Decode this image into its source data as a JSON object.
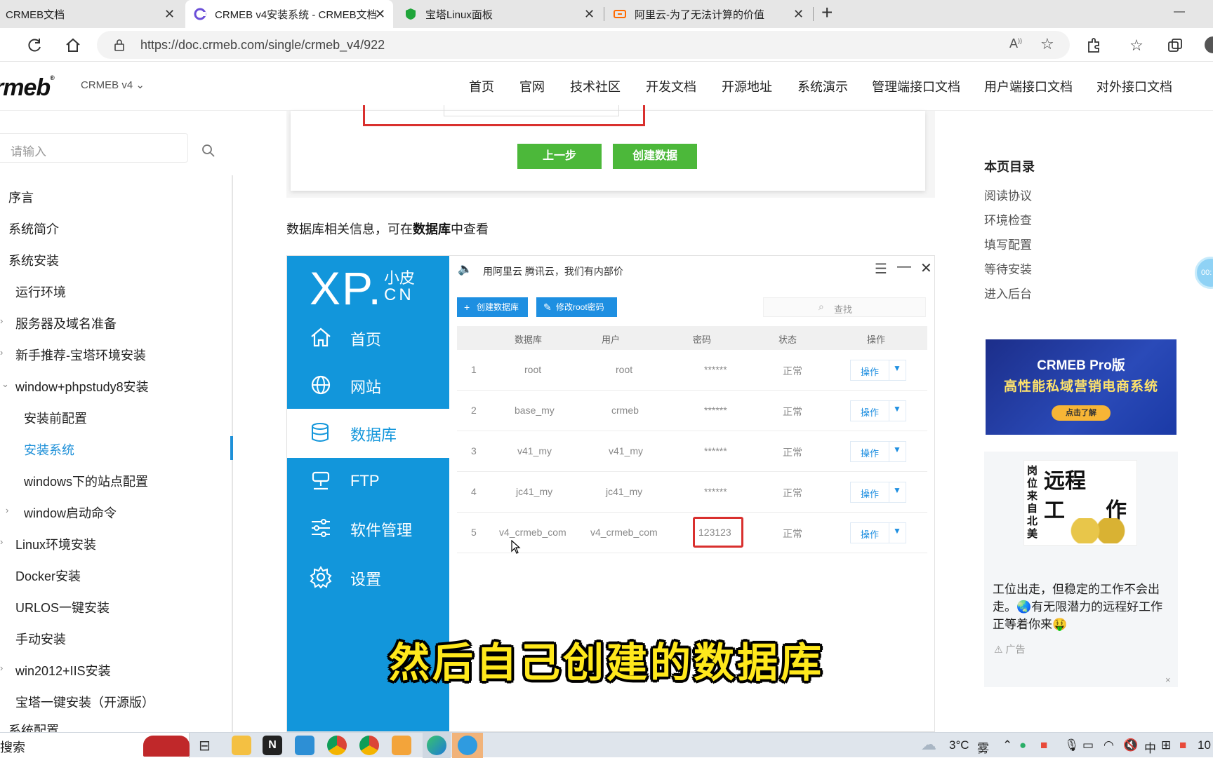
{
  "browser": {
    "tabs": [
      {
        "title": "CRMEB文档",
        "active": false
      },
      {
        "title": "CRMEB v4安装系统 - CRMEB文档",
        "active": true
      },
      {
        "title": "宝塔Linux面板",
        "active": false
      },
      {
        "title": "阿里云-为了无法计算的价值",
        "active": false
      }
    ],
    "new_tab": "+",
    "url": "https://doc.crmeb.com/single/crmeb_v4/922",
    "window_minimize": "—"
  },
  "site": {
    "logo": "rmeb",
    "logo_reg": "®",
    "version": "CRMEB v4",
    "nav": [
      "首页",
      "官网",
      "技术社区",
      "开发文档",
      "开源地址",
      "系统演示",
      "管理端接口文档",
      "用户端接口文档",
      "对外接口文档"
    ]
  },
  "sidebar": {
    "search_placeholder": "请输入",
    "items": [
      {
        "label": "序言"
      },
      {
        "label": "系统简介"
      },
      {
        "label": "系统安装"
      },
      {
        "label": "运行环境"
      },
      {
        "label": "服务器及域名准备"
      },
      {
        "label": "新手推荐-宝塔环境安装"
      },
      {
        "label": "window+phpstudy8安装"
      },
      {
        "label": "安装前配置"
      },
      {
        "label": "安装系统",
        "active": true
      },
      {
        "label": "windows下的站点配置"
      },
      {
        "label": "window启动命令"
      },
      {
        "label": "Linux环境安装"
      },
      {
        "label": "Docker安装"
      },
      {
        "label": "URLOS一键安装"
      },
      {
        "label": "手动安装"
      },
      {
        "label": "win2012+IIS安装"
      },
      {
        "label": "宝塔一键安装（开源版）"
      },
      {
        "label": "系统配置"
      }
    ]
  },
  "content": {
    "btn_prev": "上一步",
    "btn_create": "创建数据",
    "para_pre": "数据库相关信息，可在",
    "para_bold": "数据库",
    "para_post": "中查看"
  },
  "xp": {
    "logo": "XP.",
    "logo_cn1": "小皮",
    "logo_cn2": "CN",
    "menu": [
      {
        "label": "首页",
        "icon": "home-icon"
      },
      {
        "label": "网站",
        "icon": "globe-icon"
      },
      {
        "label": "数据库",
        "icon": "database-icon",
        "active": true
      },
      {
        "label": "FTP",
        "icon": "ftp-icon"
      },
      {
        "label": "软件管理",
        "icon": "sliders-icon"
      },
      {
        "label": "设置",
        "icon": "gear-icon"
      }
    ],
    "ad_text": "用阿里云 腾讯云，我们有内部价",
    "btn_create_db": "创建数据库",
    "btn_change_root": "修改root密码",
    "search_placeholder": "查找",
    "columns": [
      "数据库",
      "用户",
      "密码",
      "状态",
      "操作"
    ],
    "rows": [
      {
        "no": "1",
        "db": "root",
        "user": "root",
        "pwd": "******",
        "status": "正常",
        "op": "操作"
      },
      {
        "no": "2",
        "db": "base_my",
        "user": "crmeb",
        "pwd": "******",
        "status": "正常",
        "op": "操作"
      },
      {
        "no": "3",
        "db": "v41_my",
        "user": "v41_my",
        "pwd": "******",
        "status": "正常",
        "op": "操作"
      },
      {
        "no": "4",
        "db": "jc41_my",
        "user": "jc41_my",
        "pwd": "******",
        "status": "正常",
        "op": "操作"
      },
      {
        "no": "5",
        "db": "v4_crmeb_com",
        "user": "v4_crmeb_com",
        "pwd": "123123",
        "status": "正常",
        "op": "操作"
      }
    ]
  },
  "toc": {
    "title": "本页目录",
    "items": [
      "阅读协议",
      "环境检查",
      "填写配置",
      "等待安装",
      "进入后台"
    ]
  },
  "ads": {
    "ad1_title": "CRMEB Pro版",
    "ad1_slogan": "高性能私域营销电商系统",
    "ad1_btn": "点击了解",
    "ad2_img_big1": "远程",
    "ad2_img_big2": "工",
    "ad2_img_big3": "作",
    "ad2_img_side": "岗位来自北美",
    "ad2_text": "工位出走，但稳定的工作不会出走。🌏有无限潜力的远程好工作正等着你来🤑",
    "ad2_tag": "广告",
    "ad2_close": "×",
    "timer": "00:"
  },
  "subtitle": "然后自己创建的数据库",
  "taskbar": {
    "search": "搜索",
    "temp": "3°C",
    "weather": "雾",
    "ime": "中",
    "clock": "10"
  }
}
